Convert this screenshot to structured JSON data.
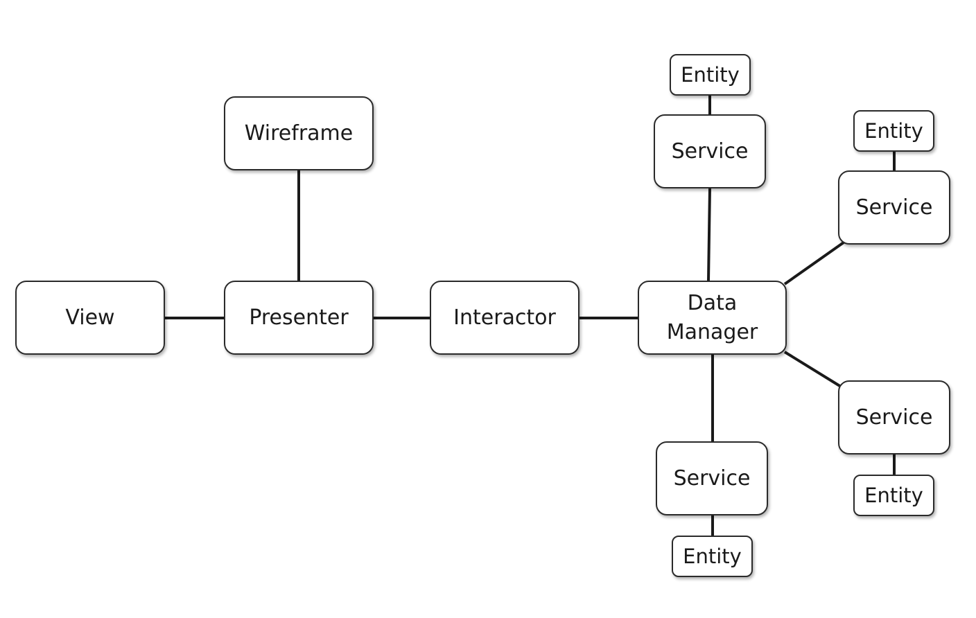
{
  "nodes": {
    "view": "View",
    "presenter": "Presenter",
    "wireframe": "Wireframe",
    "interactor": "Interactor",
    "data_manager": "Data\nManager",
    "service_top": "Service",
    "entity_top": "Entity",
    "service_right_top": "Service",
    "entity_right_top": "Entity",
    "service_right_bottom": "Service",
    "entity_right_bottom": "Entity",
    "service_bottom": "Service",
    "entity_bottom": "Entity"
  },
  "edges": [
    [
      "view",
      "presenter"
    ],
    [
      "wireframe",
      "presenter"
    ],
    [
      "presenter",
      "interactor"
    ],
    [
      "interactor",
      "data_manager"
    ],
    [
      "data_manager",
      "service_top"
    ],
    [
      "service_top",
      "entity_top"
    ],
    [
      "data_manager",
      "service_right_top"
    ],
    [
      "service_right_top",
      "entity_right_top"
    ],
    [
      "data_manager",
      "service_right_bottom"
    ],
    [
      "service_right_bottom",
      "entity_right_bottom"
    ],
    [
      "data_manager",
      "service_bottom"
    ],
    [
      "service_bottom",
      "entity_bottom"
    ]
  ]
}
